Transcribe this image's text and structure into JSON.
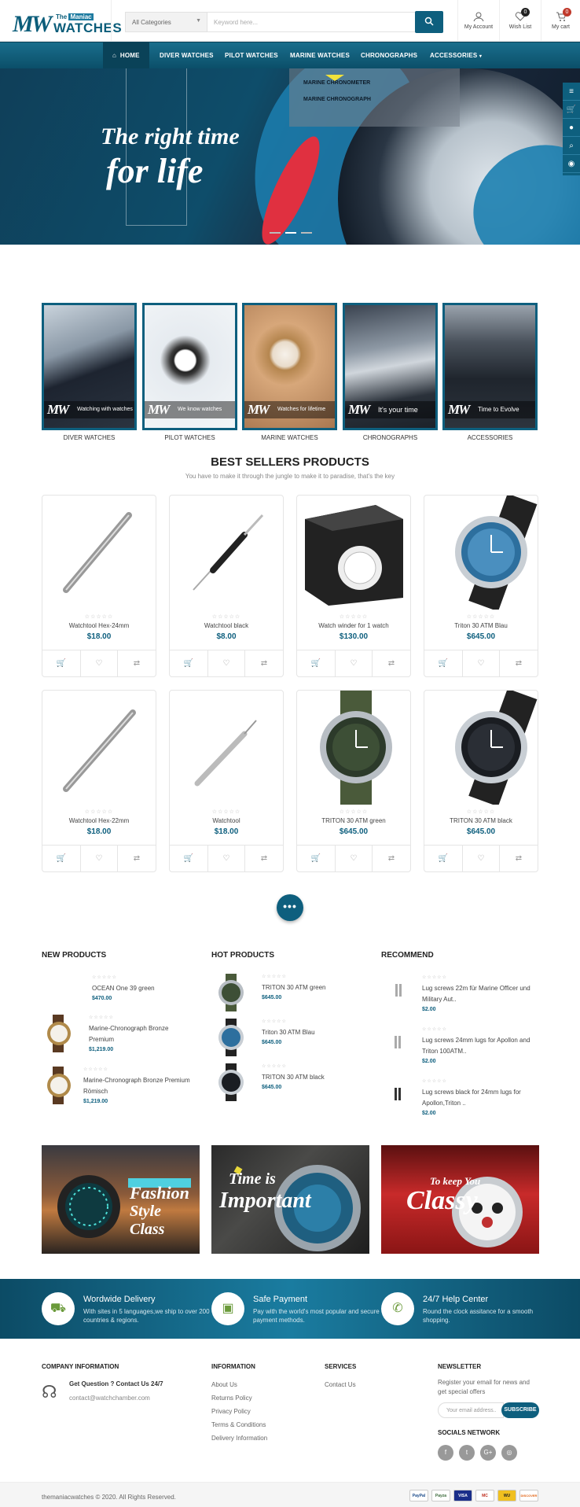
{
  "header": {
    "logo_small": "The",
    "logo_tag": "Maniac",
    "logo_main": "WATCHES",
    "category_select": "All Categories",
    "search_placeholder": "Keyword here...",
    "account_label": "My Account",
    "wishlist_label": "Wish List",
    "wishlist_count": "0",
    "cart_label": "My cart",
    "cart_count": "0"
  },
  "nav": {
    "items": [
      "HOME",
      "DIVER WATCHES",
      "PILOT WATCHES",
      "MARINE WATCHES",
      "CHRONOGRAPHS",
      "ACCESSORIES"
    ],
    "dropdown": [
      "MARINE CHRONOMETER",
      "MARINE CHRONOGRAPH"
    ]
  },
  "hero": {
    "line1": "The right time",
    "line2": "for life"
  },
  "categories": [
    {
      "caption": "Watching with watches",
      "label": "DIVER WATCHES"
    },
    {
      "caption": "We know watches",
      "label": "PILOT WATCHES"
    },
    {
      "caption": "Watches for lifetime",
      "label": "MARINE WATCHES"
    },
    {
      "caption": "It's your time",
      "label": "CHRONOGRAPHS"
    },
    {
      "caption": "Time to Evolve",
      "label": "ACCESSORIES"
    }
  ],
  "bestsellers": {
    "title": "BEST SELLERS PRODUCTS",
    "subtitle": "You have to make it through the jungle to make it to paradise, that's the key"
  },
  "products": [
    {
      "name": "Watchtool Hex-24mm",
      "price": "$18.00"
    },
    {
      "name": "Watchtool black",
      "price": "$8.00"
    },
    {
      "name": "Watch winder for 1 watch",
      "price": "$130.00"
    },
    {
      "name": "Triton 30 ATM Blau",
      "price": "$645.00"
    },
    {
      "name": "Watchtool Hex-22mm",
      "price": "$18.00"
    },
    {
      "name": "Watchtool",
      "price": "$18.00"
    },
    {
      "name": "TRITON 30 ATM green",
      "price": "$645.00"
    },
    {
      "name": "TRITON 30 ATM black",
      "price": "$645.00"
    }
  ],
  "lists": {
    "new": {
      "title": "NEW PRODUCTS",
      "items": [
        {
          "name": "OCEAN One 39 green",
          "price": "$470.00"
        },
        {
          "name": "Marine-Chronograph Bronze Premium",
          "price": "$1,219.00"
        },
        {
          "name": "Marine-Chronograph Bronze Premium Römisch",
          "price": "$1,219.00"
        }
      ]
    },
    "hot": {
      "title": "HOT PRODUCTS",
      "items": [
        {
          "name": "TRITON 30 ATM green",
          "price": "$645.00"
        },
        {
          "name": "Triton 30 ATM Blau",
          "price": "$645.00"
        },
        {
          "name": "TRITON 30 ATM black",
          "price": "$645.00"
        }
      ]
    },
    "rec": {
      "title": "RECOMMEND",
      "items": [
        {
          "name": "Lug screws 22m für Marine Officer und Military Aut..",
          "price": "$2.00"
        },
        {
          "name": "Lug screws 24mm lugs for Apollon and Triton 100ATM..",
          "price": "$2.00"
        },
        {
          "name": "Lug screws black for 24mm lugs for Apollon,Triton ..",
          "price": "$2.00"
        }
      ]
    }
  },
  "banners": [
    {
      "l1": "Fashion",
      "l2": "Style Class"
    },
    {
      "l1": "Time is",
      "l2": "Important"
    },
    {
      "l1": "To keep You",
      "l2": "Classy"
    }
  ],
  "features": [
    {
      "title": "Wordwide Delivery",
      "desc": "With sites in 5 languages,we ship to over 200 countries & regions."
    },
    {
      "title": "Safe Payment",
      "desc": "Pay with the world's most popular and secure payment methods."
    },
    {
      "title": "24/7 Help Center",
      "desc": "Round the clock assitance for a smooth shopping."
    }
  ],
  "footer": {
    "company_title": "COMPANY INFORMATION",
    "question": "Get Question ? Contact Us 24/7",
    "email": "contact@watchchamber.com",
    "info_title": "INFORMATION",
    "info_links": [
      "About Us",
      "Returns Policy",
      "Privacy Policy",
      "Terms & Conditions",
      "Delivery Information"
    ],
    "services_title": "SERVICES",
    "services_links": [
      "Contact Us"
    ],
    "newsletter_title": "NEWSLETTER",
    "newsletter_desc": "Register your email for news and get special offers",
    "newsletter_placeholder": "Your email address..",
    "subscribe": "SUBSCRIBE",
    "social_title": "SOCIALS NETWORK",
    "social": [
      "f",
      "t",
      "G+",
      "◎"
    ],
    "copyright": "themaniacwatches © 2020. All Rights Reserved.",
    "payments": [
      "PayPal",
      "Payza",
      "VISA",
      "MC",
      "WU",
      "DISCOVER"
    ]
  },
  "colors": {
    "primary": "#0e5f7e",
    "badge": "#c0392b"
  }
}
